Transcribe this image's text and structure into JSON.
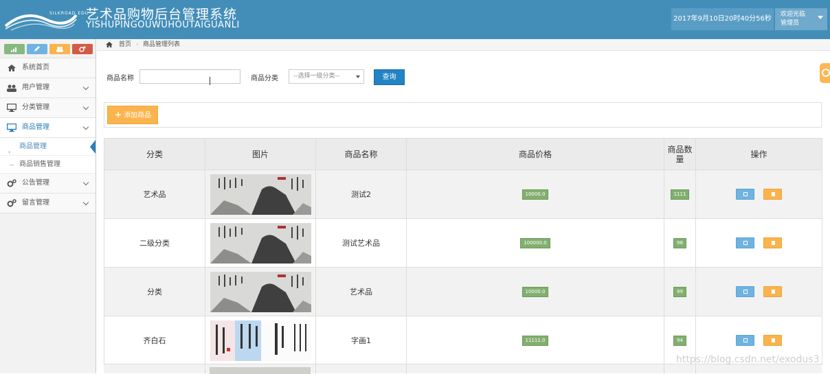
{
  "header": {
    "logo_subtext": "SILKROAD EDU",
    "title_cn": "艺术品购物后台管理系统",
    "title_en": "YISHUPINGOUWUHOUTAIGUANLI",
    "datetime": "2017年9月10日20时40分56秒",
    "welcome": "欢迎光临",
    "username": "管理员",
    "bg_color": "#438eb9"
  },
  "shortcuts": [
    {
      "icon": "signal-icon",
      "color": "#87b87f"
    },
    {
      "icon": "pencil-icon",
      "color": "#6fb3e0"
    },
    {
      "icon": "users-icon",
      "color": "#fbb34d"
    },
    {
      "icon": "cogs-icon",
      "color": "#d15b47"
    }
  ],
  "sidebar": {
    "items": [
      {
        "label": "系统首页",
        "icon": "home-icon"
      },
      {
        "label": "用户管理",
        "icon": "users-icon"
      },
      {
        "label": "分类管理",
        "icon": "desktop-icon"
      },
      {
        "label": "商品管理",
        "icon": "desktop-icon"
      },
      {
        "label": "公告管理",
        "icon": "cogs-icon"
      },
      {
        "label": "留言管理",
        "icon": "cogs-icon"
      }
    ],
    "sub_items": [
      {
        "label": "商品管理"
      },
      {
        "label": "商品销售管理"
      }
    ]
  },
  "breadcrumb": {
    "home": "首页",
    "current": "商品管理列表"
  },
  "search": {
    "name_label": "商品名称",
    "name_value": "",
    "category_label": "商品分类",
    "category_selected": "--选择一级分类--",
    "query_button": "查询"
  },
  "toolbar": {
    "add_button": "添加商品"
  },
  "table": {
    "headers": [
      "分类",
      "图片",
      "商品名称",
      "商品价格",
      "商品数量",
      "操作"
    ],
    "rows": [
      {
        "category": "艺术品",
        "image": "ink-landscape",
        "name": "测试2",
        "price": "10000.0",
        "quantity": "1111"
      },
      {
        "category": "二级分类",
        "image": "ink-landscape",
        "name": "测试艺术品",
        "price": "100000.0",
        "quantity": "98"
      },
      {
        "category": "分类",
        "image": "ink-landscape",
        "name": "艺术品",
        "price": "10000.0",
        "quantity": "99"
      },
      {
        "category": "齐白石",
        "image": "calligraphy",
        "name": "字画1",
        "price": "11111.0",
        "quantity": "94"
      }
    ]
  },
  "watermark": "https://blog.csdn.net/exodus3"
}
